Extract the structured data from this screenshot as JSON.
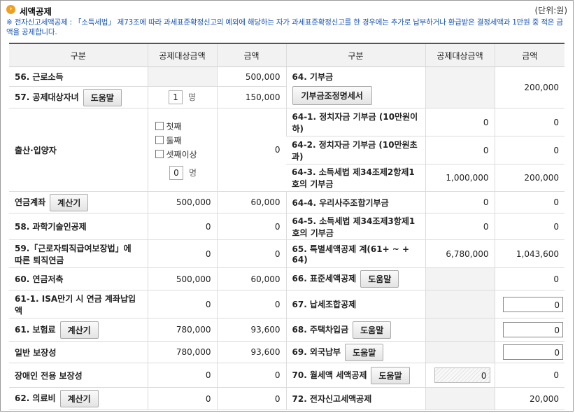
{
  "header": {
    "title": "세액공제",
    "unit": "(단위:원)"
  },
  "note": "※ 전자신고세액공제 : 「소득세법」 제73조에 따라 과세표준확정신고의 예외에 해당하는 자가 과세표준확정신고를 한 경우에는 추가로 납부하거나 환급받은 결정세액과 1만원 중 적은 금액을 공제합니다.",
  "columns": {
    "left_category": "구분",
    "left_target": "공제대상금액",
    "left_amount": "금액",
    "right_category": "구분",
    "right_target": "공제대상금액",
    "right_amount": "금액"
  },
  "buttons": {
    "help": "도움말",
    "calc": "계산기",
    "donation_detail": "기부금조정명세서"
  },
  "person_unit": "명",
  "left": {
    "r56": {
      "label": "56. 근로소득",
      "target": "",
      "amount": "500,000"
    },
    "r57": {
      "label": "57. 공제대상자녀",
      "count": "1",
      "amount": "150,000"
    },
    "birth": {
      "label": "출산·입양자",
      "options": [
        "첫째",
        "둘째",
        "셋째이상"
      ],
      "count": "0",
      "amount": "0"
    },
    "pension_account": {
      "label": "연금계좌",
      "target": "500,000",
      "amount": "60,000"
    },
    "r58": {
      "label": "58. 과학기술인공제",
      "target": "0",
      "amount": "0"
    },
    "r59": {
      "label": "59.「근로자퇴직급여보장법」에 따른 퇴직연금",
      "target": "0",
      "amount": "0"
    },
    "r60": {
      "label": "60. 연금저축",
      "target": "500,000",
      "amount": "60,000"
    },
    "r61_1": {
      "label": "61-1. ISA만기 시 연금 계좌납입액",
      "target": "0",
      "amount": "0"
    },
    "r61": {
      "label": "61. 보험료",
      "target": "780,000",
      "amount": "93,600"
    },
    "general": {
      "label": "일반 보장성",
      "target": "780,000",
      "amount": "93,600"
    },
    "disabled": {
      "label": "장애인 전용 보장성",
      "target": "0",
      "amount": "0"
    },
    "r62": {
      "label": "62. 의료비",
      "target": "0",
      "amount": "0"
    }
  },
  "right": {
    "r64": {
      "label": "64. 기부금",
      "target": "",
      "amount": "200,000"
    },
    "r64_1": {
      "label": "64-1. 정치자금 기부금 (10만원이하)",
      "target": "0",
      "amount": "0"
    },
    "r64_2": {
      "label": "64-2. 정치자금 기부금 (10만원초과)",
      "target": "0",
      "amount": "0"
    },
    "r64_3": {
      "label": "64-3. 소득세법 제34조제2항제1호의 기부금",
      "target": "1,000,000",
      "amount": "200,000"
    },
    "r64_4": {
      "label": "64-4. 우리사주조합기부금",
      "target": "0",
      "amount": "0"
    },
    "r64_5": {
      "label": "64-5. 소득세법 제34조제3항제1호의 기부금",
      "target": "0",
      "amount": "0"
    },
    "r65": {
      "label": "65. 특별세액공제 계(61+ ~ + 64)",
      "target": "6,780,000",
      "amount": "1,043,600"
    },
    "r66": {
      "label": "66. 표준세액공제",
      "target": "",
      "amount": "0"
    },
    "r67": {
      "label": "67. 납세조합공제",
      "value": "0"
    },
    "r68": {
      "label": "68. 주택차입금",
      "value": "0"
    },
    "r69": {
      "label": "69. 외국납부",
      "value": "0"
    },
    "r70": {
      "label": "70. 월세액 세액공제",
      "target": "0",
      "amount": "0"
    },
    "r72": {
      "label": "72. 전자신고세액공제",
      "target": "",
      "amount": "20,000"
    }
  }
}
